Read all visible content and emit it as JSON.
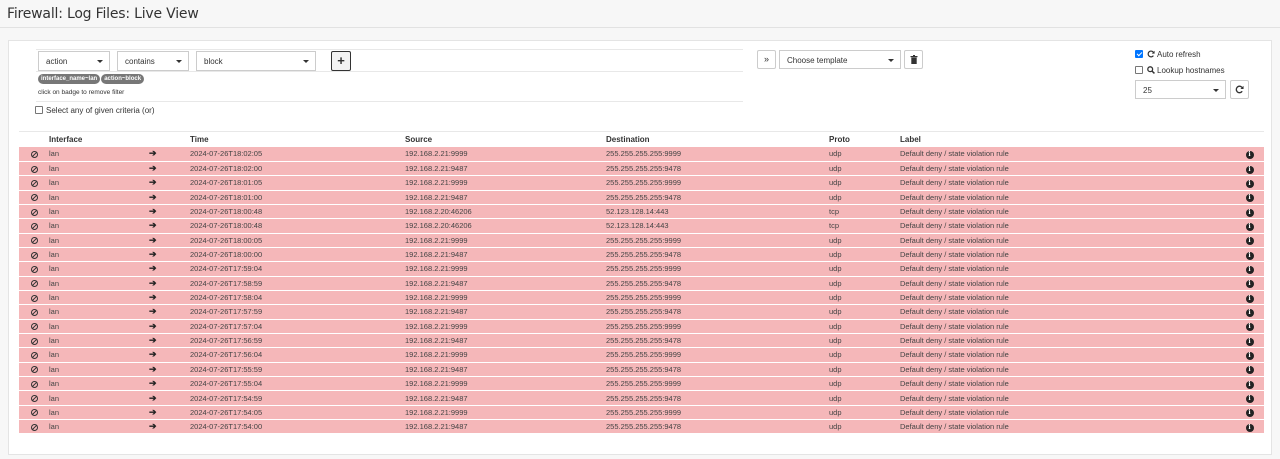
{
  "page": {
    "title": "Firewall: Log Files: Live View"
  },
  "filter": {
    "field": "action",
    "operator": "contains",
    "value": "block",
    "add_label": "+",
    "badges": [
      "interface_name~lan",
      "action~block"
    ],
    "hint": "click on badge to remove filter",
    "any_criteria_label": "Select any of given criteria (or)",
    "any_criteria_checked": false
  },
  "template": {
    "expand_label": "»",
    "placeholder": "Choose template",
    "delete_icon": "trash-icon"
  },
  "options": {
    "auto_refresh_label": "Auto refresh",
    "auto_refresh_checked": true,
    "lookup_hostnames_label": "Lookup hostnames",
    "lookup_hostnames_checked": false,
    "page_size": "25"
  },
  "table": {
    "columns": [
      "",
      "Interface",
      "",
      "Time",
      "Source",
      "Destination",
      "Proto",
      "Label",
      ""
    ],
    "row_color": "#f5b7b9",
    "rows": [
      {
        "interface": "lan",
        "time": "2024-07-26T18:02:05",
        "source": "192.168.2.21:9999",
        "destination": "255.255.255.255:9999",
        "proto": "udp",
        "label": "Default deny / state violation rule"
      },
      {
        "interface": "lan",
        "time": "2024-07-26T18:02:00",
        "source": "192.168.2.21:9487",
        "destination": "255.255.255.255:9478",
        "proto": "udp",
        "label": "Default deny / state violation rule"
      },
      {
        "interface": "lan",
        "time": "2024-07-26T18:01:05",
        "source": "192.168.2.21:9999",
        "destination": "255.255.255.255:9999",
        "proto": "udp",
        "label": "Default deny / state violation rule"
      },
      {
        "interface": "lan",
        "time": "2024-07-26T18:01:00",
        "source": "192.168.2.21:9487",
        "destination": "255.255.255.255:9478",
        "proto": "udp",
        "label": "Default deny / state violation rule"
      },
      {
        "interface": "lan",
        "time": "2024-07-26T18:00:48",
        "source": "192.168.2.20:46206",
        "destination": "52.123.128.14:443",
        "proto": "tcp",
        "label": "Default deny / state violation rule"
      },
      {
        "interface": "lan",
        "time": "2024-07-26T18:00:48",
        "source": "192.168.2.20:46206",
        "destination": "52.123.128.14:443",
        "proto": "tcp",
        "label": "Default deny / state violation rule"
      },
      {
        "interface": "lan",
        "time": "2024-07-26T18:00:05",
        "source": "192.168.2.21:9999",
        "destination": "255.255.255.255:9999",
        "proto": "udp",
        "label": "Default deny / state violation rule"
      },
      {
        "interface": "lan",
        "time": "2024-07-26T18:00:00",
        "source": "192.168.2.21:9487",
        "destination": "255.255.255.255:9478",
        "proto": "udp",
        "label": "Default deny / state violation rule"
      },
      {
        "interface": "lan",
        "time": "2024-07-26T17:59:04",
        "source": "192.168.2.21:9999",
        "destination": "255.255.255.255:9999",
        "proto": "udp",
        "label": "Default deny / state violation rule"
      },
      {
        "interface": "lan",
        "time": "2024-07-26T17:58:59",
        "source": "192.168.2.21:9487",
        "destination": "255.255.255.255:9478",
        "proto": "udp",
        "label": "Default deny / state violation rule"
      },
      {
        "interface": "lan",
        "time": "2024-07-26T17:58:04",
        "source": "192.168.2.21:9999",
        "destination": "255.255.255.255:9999",
        "proto": "udp",
        "label": "Default deny / state violation rule"
      },
      {
        "interface": "lan",
        "time": "2024-07-26T17:57:59",
        "source": "192.168.2.21:9487",
        "destination": "255.255.255.255:9478",
        "proto": "udp",
        "label": "Default deny / state violation rule"
      },
      {
        "interface": "lan",
        "time": "2024-07-26T17:57:04",
        "source": "192.168.2.21:9999",
        "destination": "255.255.255.255:9999",
        "proto": "udp",
        "label": "Default deny / state violation rule"
      },
      {
        "interface": "lan",
        "time": "2024-07-26T17:56:59",
        "source": "192.168.2.21:9487",
        "destination": "255.255.255.255:9478",
        "proto": "udp",
        "label": "Default deny / state violation rule"
      },
      {
        "interface": "lan",
        "time": "2024-07-26T17:56:04",
        "source": "192.168.2.21:9999",
        "destination": "255.255.255.255:9999",
        "proto": "udp",
        "label": "Default deny / state violation rule"
      },
      {
        "interface": "lan",
        "time": "2024-07-26T17:55:59",
        "source": "192.168.2.21:9487",
        "destination": "255.255.255.255:9478",
        "proto": "udp",
        "label": "Default deny / state violation rule"
      },
      {
        "interface": "lan",
        "time": "2024-07-26T17:55:04",
        "source": "192.168.2.21:9999",
        "destination": "255.255.255.255:9999",
        "proto": "udp",
        "label": "Default deny / state violation rule"
      },
      {
        "interface": "lan",
        "time": "2024-07-26T17:54:59",
        "source": "192.168.2.21:9487",
        "destination": "255.255.255.255:9478",
        "proto": "udp",
        "label": "Default deny / state violation rule"
      },
      {
        "interface": "lan",
        "time": "2024-07-26T17:54:05",
        "source": "192.168.2.21:9999",
        "destination": "255.255.255.255:9999",
        "proto": "udp",
        "label": "Default deny / state violation rule"
      },
      {
        "interface": "lan",
        "time": "2024-07-26T17:54:00",
        "source": "192.168.2.21:9487",
        "destination": "255.255.255.255:9478",
        "proto": "udp",
        "label": "Default deny / state violation rule"
      }
    ]
  }
}
